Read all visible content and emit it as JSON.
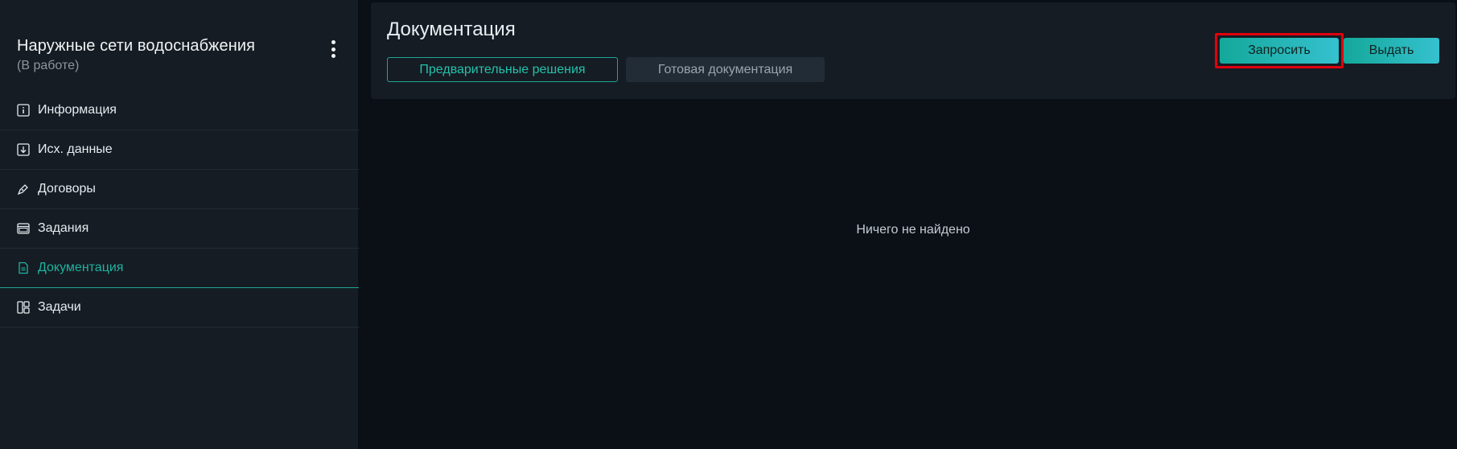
{
  "sidebar": {
    "project_title": "Наружные сети водоснабжения",
    "project_status": "(В работе)",
    "items": [
      {
        "label": "Информация",
        "icon": "info-icon"
      },
      {
        "label": "Исх. данные",
        "icon": "download-icon"
      },
      {
        "label": "Договоры",
        "icon": "pen-icon"
      },
      {
        "label": "Задания",
        "icon": "window-icon"
      },
      {
        "label": "Документация",
        "icon": "document-icon",
        "active": true
      },
      {
        "label": "Задачи",
        "icon": "layout-icon"
      }
    ]
  },
  "main": {
    "title": "Документация",
    "tabs": [
      {
        "label": "Предварительные решения",
        "active": true
      },
      {
        "label": "Готовая документация",
        "active": false
      }
    ],
    "actions": {
      "request_label": "Запросить",
      "issue_label": "Выдать"
    },
    "empty_message": "Ничего не найдено"
  },
  "colors": {
    "accent": "#1fb3a0",
    "highlight": "#e0000e",
    "background": "#0b1016",
    "panel": "#151c23"
  }
}
